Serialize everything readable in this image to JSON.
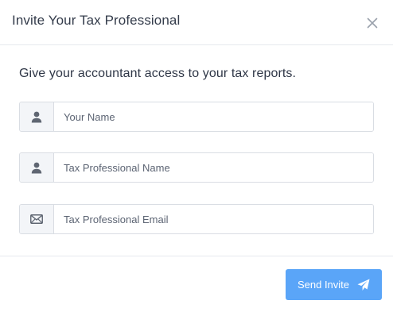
{
  "modal": {
    "title": "Invite Your Tax Professional",
    "close_icon": "close-icon"
  },
  "body": {
    "intro": "Give your accountant access to your tax reports.",
    "fields": [
      {
        "icon": "user-icon",
        "placeholder": "Your Name",
        "value": ""
      },
      {
        "icon": "user-icon",
        "placeholder": "Tax Professional Name",
        "value": ""
      },
      {
        "icon": "envelope-icon",
        "placeholder": "Tax Professional Email",
        "value": ""
      }
    ]
  },
  "footer": {
    "send_label": "Send Invite",
    "send_icon": "paper-plane-icon"
  },
  "colors": {
    "primary_button": "#5aa5f8",
    "addon_background": "#f3f5f8",
    "border": "#d9dde3",
    "title_text": "#343c4b"
  }
}
